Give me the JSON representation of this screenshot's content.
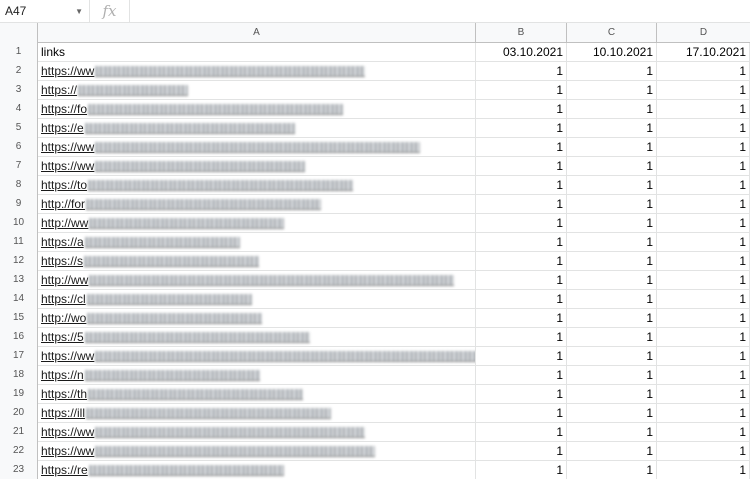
{
  "formula_bar": {
    "cell_ref": "A47",
    "fx_label": "fx",
    "formula": ""
  },
  "columns": [
    "A",
    "B",
    "C",
    "D"
  ],
  "rows": [
    {
      "num": "1",
      "a": "links",
      "b": "03.10.2021",
      "c": "10.10.2021",
      "d": "17.10.2021",
      "header": true
    },
    {
      "num": "2",
      "a": "https://ww",
      "b": "1",
      "c": "1",
      "d": "1"
    },
    {
      "num": "3",
      "a": "https://",
      "b": "1",
      "c": "1",
      "d": "1"
    },
    {
      "num": "4",
      "a": "https://fo",
      "b": "1",
      "c": "1",
      "d": "1"
    },
    {
      "num": "5",
      "a": "https://e",
      "b": "1",
      "c": "1",
      "d": "1"
    },
    {
      "num": "6",
      "a": "https://ww",
      "b": "1",
      "c": "1",
      "d": "1"
    },
    {
      "num": "7",
      "a": "https://ww",
      "b": "1",
      "c": "1",
      "d": "1"
    },
    {
      "num": "8",
      "a": "https://to",
      "b": "1",
      "c": "1",
      "d": "1"
    },
    {
      "num": "9",
      "a": "http://for",
      "b": "1",
      "c": "1",
      "d": "1"
    },
    {
      "num": "10",
      "a": "http://ww",
      "b": "1",
      "c": "1",
      "d": "1"
    },
    {
      "num": "11",
      "a": "https://a",
      "b": "1",
      "c": "1",
      "d": "1"
    },
    {
      "num": "12",
      "a": "https://s",
      "b": "1",
      "c": "1",
      "d": "1"
    },
    {
      "num": "13",
      "a": "http://ww",
      "b": "1",
      "c": "1",
      "d": "1"
    },
    {
      "num": "14",
      "a": "https://cl",
      "b": "1",
      "c": "1",
      "d": "1"
    },
    {
      "num": "15",
      "a": "http://wo",
      "b": "1",
      "c": "1",
      "d": "1"
    },
    {
      "num": "16",
      "a": "https://5",
      "b": "1",
      "c": "1",
      "d": "1"
    },
    {
      "num": "17",
      "a": "https://ww",
      "b": "1",
      "c": "1",
      "d": "1"
    },
    {
      "num": "18",
      "a": "https://n",
      "b": "1",
      "c": "1",
      "d": "1"
    },
    {
      "num": "19",
      "a": "https://th",
      "b": "1",
      "c": "1",
      "d": "1"
    },
    {
      "num": "20",
      "a": "https://ill",
      "b": "1",
      "c": "1",
      "d": "1"
    },
    {
      "num": "21",
      "a": "https://ww",
      "b": "1",
      "c": "1",
      "d": "1"
    },
    {
      "num": "22",
      "a": "https://ww",
      "b": "1",
      "c": "1",
      "d": "1"
    },
    {
      "num": "23",
      "a": "https://re",
      "b": "1",
      "c": "1",
      "d": "1"
    }
  ]
}
